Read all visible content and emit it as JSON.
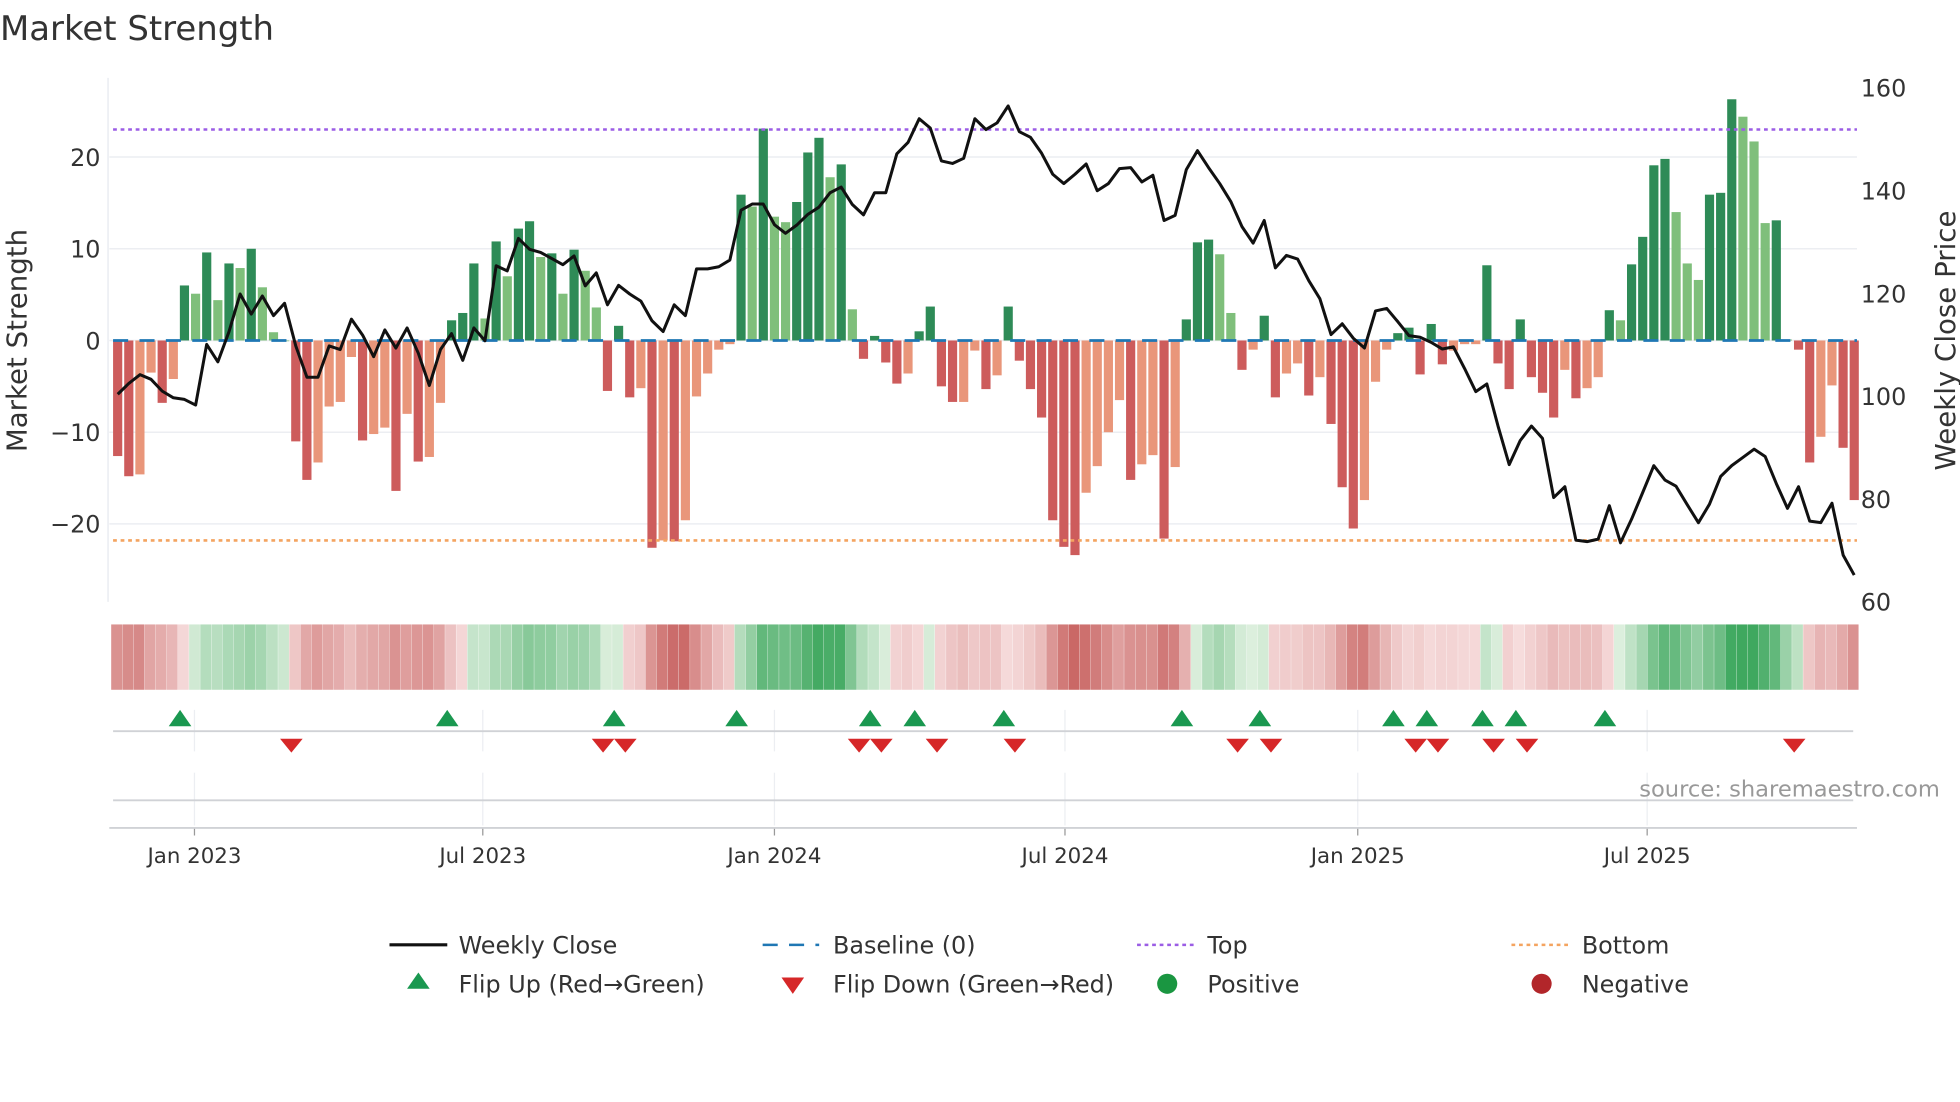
{
  "chart_data": {
    "type": "bar",
    "title": "Market Strength",
    "ylabel": "Market Strength",
    "y2label": "Weekly Close Price",
    "ylim": [
      -28.5,
      28.2
    ],
    "y2lim": [
      60,
      160
    ],
    "yticks": [
      {
        "v": 20,
        "label": "20"
      },
      {
        "v": 10,
        "label": "10"
      },
      {
        "v": 0,
        "label": "0"
      },
      {
        "v": -10,
        "label": "−10"
      },
      {
        "v": -20,
        "label": "−20"
      }
    ],
    "y2ticks": [
      {
        "v": 160,
        "label": "160"
      },
      {
        "v": 140,
        "label": "140"
      },
      {
        "v": 120,
        "label": "120"
      },
      {
        "v": 100,
        "label": "100"
      },
      {
        "v": 80,
        "label": "80"
      },
      {
        "v": 60,
        "label": "60"
      }
    ],
    "xticks": [
      {
        "week": 6.9,
        "label": "Jan 2023"
      },
      {
        "week": 32.8,
        "label": "Jul 2023"
      },
      {
        "week": 59,
        "label": "Jan 2024"
      },
      {
        "week": 85.1,
        "label": "Jul 2024"
      },
      {
        "week": 111.4,
        "label": "Jan 2025"
      },
      {
        "week": 137.4,
        "label": "Jul 2025"
      }
    ],
    "top_level": 23,
    "bottom_level": -21.8,
    "baseline": 0,
    "strength": [
      -12.6,
      -14.8,
      -14.6,
      -3.5,
      -6.8,
      -4.2,
      6,
      5.1,
      9.6,
      4.4,
      8.4,
      7.9,
      10,
      5.8,
      0.9,
      0,
      -11,
      -15.2,
      -13.3,
      -7.2,
      -6.7,
      -1.8,
      -10.9,
      -10.2,
      -9.5,
      -16.4,
      -8,
      -13.2,
      -12.7,
      -6.8,
      2.2,
      3,
      8.4,
      2.4,
      10.8,
      7,
      12.2,
      13,
      9.1,
      9.5,
      5.1,
      9.9,
      7.6,
      3.6,
      -5.5,
      1.6,
      -6.2,
      -5.2,
      -22.6,
      -21.8,
      -21.9,
      -19.6,
      -6.1,
      -3.6,
      -1,
      -0.4,
      15.9,
      14.6,
      23.1,
      13.5,
      12.9,
      15.1,
      20.5,
      22.1,
      17.8,
      19.2,
      3.4,
      -2,
      0.5,
      -2.4,
      -4.7,
      -3.6,
      1.0,
      3.7,
      -5,
      -6.7,
      -6.7,
      -1.1,
      -5.3,
      -3.8,
      3.7,
      -2.2,
      -5.3,
      -8.4,
      -19.6,
      -22.5,
      -23.4,
      -16.6,
      -13.7,
      -10,
      -6.5,
      -15.2,
      -13.5,
      -12.5,
      -21.6,
      -13.8,
      2.3,
      10.7,
      11,
      9.4,
      3.0,
      -3.2,
      -1,
      2.7,
      -6.2,
      -3.6,
      -2.5,
      -6,
      -4,
      -9.1,
      -16,
      -20.5,
      -17.4,
      -4.5,
      -1,
      0.8,
      1.4,
      -3.7,
      1.8,
      -2.6,
      -1.1,
      -0.4,
      -0.4,
      8.2,
      -2.5,
      -5.3,
      2.3,
      -4,
      -5.7,
      -8.4,
      -3.2,
      -6.3,
      -5.2,
      -4,
      3.3,
      2.2,
      8.3,
      11.3,
      19.1,
      19.8,
      14,
      8.4,
      6.6,
      15.9,
      16.1,
      26.3,
      24.4,
      21.7,
      12.8,
      13.1,
      0.1,
      -1,
      -13.3,
      -10.5,
      -4.9,
      -11.7,
      -17.4
    ],
    "weekly_close": [
      100.4,
      102.5,
      104.2,
      103.3,
      101,
      99.7,
      99.4,
      98.3,
      110.1,
      106.7,
      112.6,
      119.9,
      116,
      119.5,
      115.7,
      118.1,
      109.8,
      103.7,
      103.7,
      109.8,
      109.1,
      115,
      111.9,
      107.7,
      112.9,
      109.4,
      113.3,
      108.4,
      102.1,
      109.1,
      112.2,
      107,
      113.3,
      110.8,
      125.4,
      124.4,
      130.7,
      128.6,
      128,
      126.8,
      125.6,
      127.3,
      121.5,
      124,
      117.8,
      121.6,
      119.9,
      118.5,
      114.7,
      112.6,
      117.8,
      115.7,
      124.8,
      124.8,
      125.2,
      126.5,
      136.2,
      137.4,
      137.4,
      133.4,
      131.7,
      133.3,
      135.4,
      136.8,
      139.6,
      140.7,
      137.3,
      135.3,
      139.6,
      139.6,
      147.2,
      149.4,
      154,
      152.2,
      145.8,
      145.3,
      146.3,
      154,
      151.9,
      153.2,
      156.5,
      151.5,
      150.4,
      147.3,
      143.2,
      141.4,
      143.2,
      145.2,
      140,
      141.4,
      144.3,
      144.5,
      141.7,
      143,
      134.2,
      135.2,
      144.1,
      147.8,
      144.5,
      141.4,
      137.9,
      133,
      129.8,
      134.2,
      125,
      127.4,
      126.7,
      122.5,
      119,
      112,
      114.1,
      111.3,
      109.4,
      116.6,
      117.1,
      114.5,
      111.8,
      111.5,
      110.5,
      109.2,
      109.6,
      105.4,
      100.9,
      102.4,
      94.2,
      86.7,
      91.4,
      94.2,
      91.8,
      80.3,
      82.4,
      72,
      71.7,
      72.2,
      78.7,
      71.5,
      76.1,
      81.3,
      86.5,
      83.7,
      82.5,
      78.9,
      75.4,
      79,
      84.4,
      86.5,
      88.1,
      89.7,
      88.3,
      83,
      78.2,
      82.4,
      75.7,
      75.4,
      79.2,
      69.1,
      65.2
    ],
    "legend": {
      "placement": "bottom",
      "weekly_close": "Weekly Close",
      "baseline": "Baseline (0)",
      "top": "Top",
      "bottom": "Bottom",
      "flip_up": "Flip Up (Red→Green)",
      "flip_down": "Flip Down (Green→Red)",
      "positive": "Positive",
      "negative": "Negative"
    },
    "source": "source: sharemaestro.com",
    "colors": {
      "green_dark": "#2e8b57",
      "green_light": "#7fbf7b",
      "red_dark": "#cd5c5c",
      "red_light": "#e9967a",
      "line": "#111111",
      "baseline": "#1f77b4",
      "top": "#9b5de5",
      "bottom": "#f4a460",
      "flip_up": "#1a9850",
      "flip_down": "#d62728",
      "positive": "#1a9641",
      "negative": "#b2262a"
    }
  }
}
